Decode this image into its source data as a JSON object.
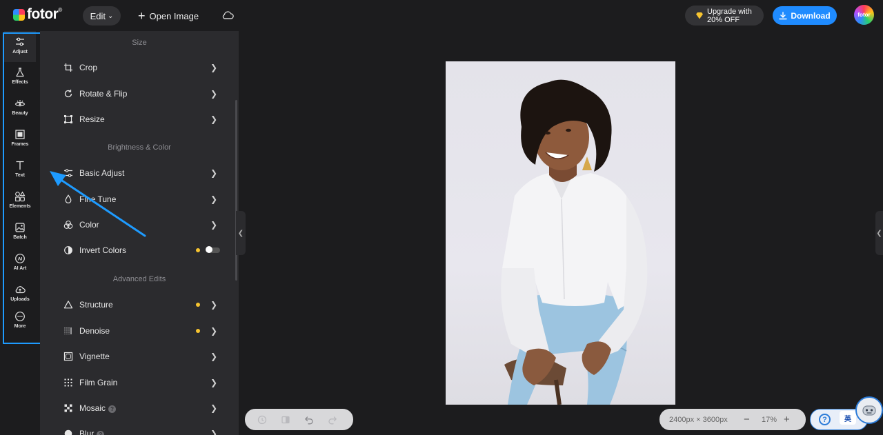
{
  "topbar": {
    "logo_text": "fotor",
    "logo_reg": "®",
    "edit_label": "Edit",
    "open_image_label": "Open Image",
    "upgrade_line1": "Upgrade with",
    "upgrade_line2": "20% OFF",
    "download_label": "Download",
    "avatar_text": "fotor"
  },
  "rail": {
    "items": [
      {
        "label": "Adjust",
        "icon": "sliders-icon"
      },
      {
        "label": "Effects",
        "icon": "flask-icon"
      },
      {
        "label": "Beauty",
        "icon": "eye-icon"
      },
      {
        "label": "Frames",
        "icon": "frame-icon"
      },
      {
        "label": "Text",
        "icon": "text-icon"
      },
      {
        "label": "Elements",
        "icon": "shapes-icon"
      },
      {
        "label": "Batch",
        "icon": "batch-icon"
      },
      {
        "label": "AI Art",
        "icon": "ai-icon"
      },
      {
        "label": "Uploads",
        "icon": "cloud-upload-icon"
      },
      {
        "label": "More",
        "icon": "more-icon"
      }
    ],
    "active": "Adjust",
    "highlight_color": "#1e9bff"
  },
  "panel": {
    "sections": {
      "size": "Size",
      "brightness": "Brightness & Color",
      "advanced": "Advanced Edits"
    },
    "items": {
      "crop": "Crop",
      "rotate": "Rotate & Flip",
      "resize": "Resize",
      "basic_adjust": "Basic Adjust",
      "fine_tune": "Fine Tune",
      "color": "Color",
      "invert_colors": "Invert Colors",
      "structure": "Structure",
      "denoise": "Denoise",
      "vignette": "Vignette",
      "film_grain": "Film Grain",
      "mosaic": "Mosaic",
      "blur": "Blur"
    },
    "invert_colors_on": false,
    "premium_dot_color": "#f7c430"
  },
  "canvas": {
    "image_size": "2400px × 3600px",
    "zoom": "17%",
    "zoom_minus": "−",
    "zoom_plus": "+"
  },
  "help": {
    "ime_label": "英"
  },
  "colors": {
    "accent": "#1f8bff",
    "background": "#1c1c1e",
    "panel": "#2b2b2e"
  }
}
